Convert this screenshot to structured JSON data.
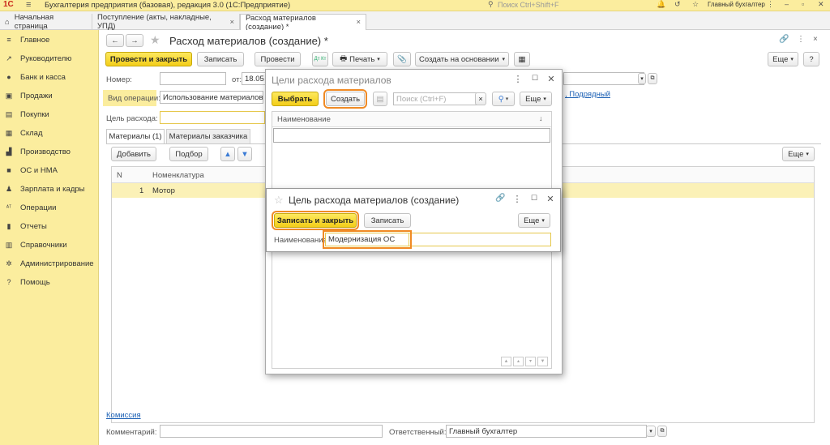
{
  "topbar": {
    "logo": "1С",
    "title": "Бухгалтерия предприятия (базовая), редакция 3.0  (1С:Предприятие)",
    "search_placeholder": "Поиск Ctrl+Shift+F",
    "user": "Главный бухгалтер"
  },
  "tabs": {
    "home": "Начальная страница",
    "t1": "Поступление (акты, накладные, УПД)",
    "t2": "Расход материалов (создание) *"
  },
  "sidebar": {
    "items": [
      {
        "label": "Главное",
        "icon": "menu-icon"
      },
      {
        "label": "Руководителю",
        "icon": "chart-icon"
      },
      {
        "label": "Банк и касса",
        "icon": "bank-icon"
      },
      {
        "label": "Продажи",
        "icon": "sales-icon"
      },
      {
        "label": "Покупки",
        "icon": "cart-icon"
      },
      {
        "label": "Склад",
        "icon": "warehouse-icon"
      },
      {
        "label": "Производство",
        "icon": "factory-icon"
      },
      {
        "label": "ОС и НМА",
        "icon": "assets-icon"
      },
      {
        "label": "Зарплата и кадры",
        "icon": "people-icon"
      },
      {
        "label": "Операции",
        "icon": "operations-icon"
      },
      {
        "label": "Отчеты",
        "icon": "reports-icon"
      },
      {
        "label": "Справочники",
        "icon": "books-icon"
      },
      {
        "label": "Администрирование",
        "icon": "gear-icon"
      },
      {
        "label": "Помощь",
        "icon": "help-icon"
      }
    ]
  },
  "doc": {
    "title": "Расход материалов (создание) *",
    "post_close": "Провести и закрыть",
    "save": "Записать",
    "post": "Провести",
    "at_kt": "Дт Кт",
    "print": "Печать",
    "create_based": "Создать на основании",
    "more": "Еще",
    "help": "?",
    "number_label": "Номер:",
    "date_label": "от:",
    "date_value": "18.05",
    "op_label": "Вид операции:",
    "op_value": "Использование материалов",
    "purpose_label": "Цель расхода:",
    "subcontract_link": ", Подрядный",
    "tab_materials": "Материалы (1)",
    "tab_customer": "Материалы заказчика",
    "add": "Добавить",
    "pick": "Подбор",
    "col_n": "N",
    "col_item": "Номенклатура",
    "row_n": "1",
    "row_item": "Мотор",
    "commission": "Комиссия",
    "comment_label": "Комментарий:",
    "responsible_label": "Ответственный:",
    "responsible_value": "Главный бухгалтер"
  },
  "dialog1": {
    "title": "Цели расхода материалов",
    "select": "Выбрать",
    "create": "Создать",
    "search_placeholder": "Поиск (Ctrl+F)",
    "more": "Еще",
    "col_name": "Наименование"
  },
  "dialog2": {
    "title": "Цель расхода материалов (создание)",
    "save_close": "Записать и закрыть",
    "save": "Записать",
    "more": "Еще",
    "name_label": "Наименование",
    "name_value": "Модернизация ОС"
  },
  "colors": {
    "accent": "#f3cd19",
    "highlight": "#f08a24",
    "panel": "#fbed9e"
  }
}
